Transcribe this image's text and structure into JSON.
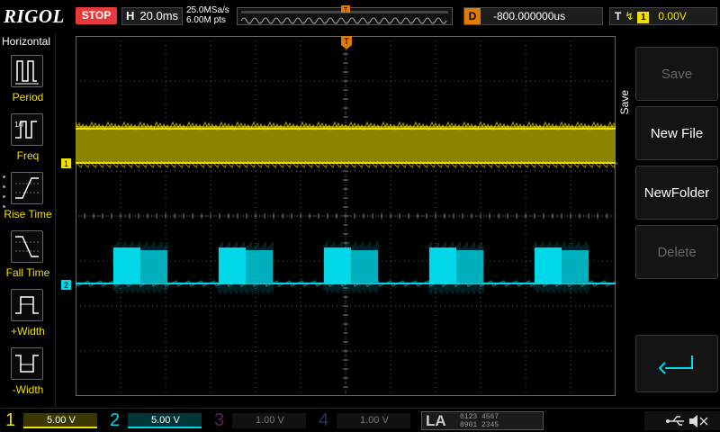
{
  "brand": "RIGOL",
  "run_state": "STOP",
  "horizontal": {
    "label": "H",
    "timebase": "20.0ms",
    "sample_rate": "25.0MSa/s",
    "memory_depth": "6.00M pts"
  },
  "delay": {
    "label": "D",
    "value": "-800.000000us"
  },
  "trigger": {
    "label": "T",
    "source": "1",
    "level": "0.00V"
  },
  "left_menu": {
    "title": "Horizontal",
    "items": [
      {
        "label": "Period",
        "icon": "period-icon"
      },
      {
        "label": "Freq",
        "icon": "frequency-icon"
      },
      {
        "label": "Rise Time",
        "icon": "rise-time-icon"
      },
      {
        "label": "Fall Time",
        "icon": "fall-time-icon"
      },
      {
        "label": "+Width",
        "icon": "positive-width-icon"
      },
      {
        "label": "-Width",
        "icon": "negative-width-icon"
      }
    ]
  },
  "right_menu": {
    "title": "Save",
    "keys": [
      {
        "label": "Save",
        "enabled": false
      },
      {
        "label": "New File",
        "enabled": true
      },
      {
        "label": "NewFolder",
        "enabled": true
      },
      {
        "label": "Delete",
        "enabled": false
      }
    ],
    "back_icon": "return-arrow-icon"
  },
  "channels": [
    {
      "num": "1",
      "scale": "5.00 V",
      "color": "#f0e000",
      "active": true
    },
    {
      "num": "2",
      "scale": "5.00 V",
      "color": "#00d8e8",
      "active": true
    },
    {
      "num": "3",
      "scale": "1.00 V",
      "color": "#cc44cc",
      "active": false
    },
    {
      "num": "4",
      "scale": "1.00 V",
      "color": "#3366cc",
      "active": false
    }
  ],
  "la": {
    "label": "LA",
    "bits_row1": "0123 4567",
    "bits_row2": "8901 2345"
  },
  "markers": {
    "ch1": "1",
    "ch2": "2",
    "trigger_top": "T",
    "trigger_right": "T"
  },
  "status_icons": [
    "usb-icon",
    "speaker-muted-icon"
  ],
  "colors": {
    "ch1": "#f0e000",
    "ch2": "#00d8e8",
    "trigger": "#e07a00",
    "stop": "#e8393b"
  }
}
